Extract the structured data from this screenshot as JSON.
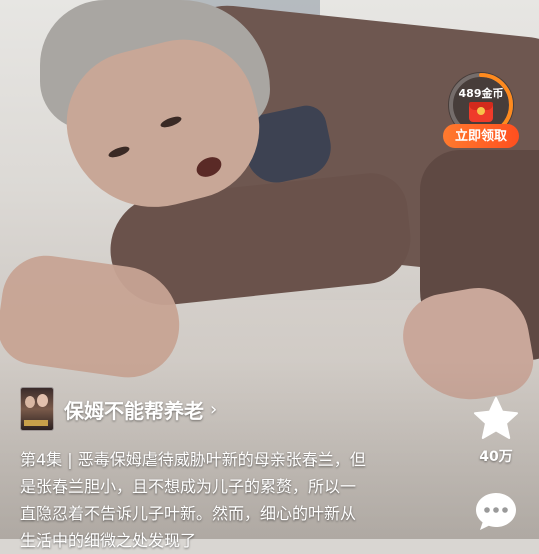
{
  "reward": {
    "coins_label": "489金币",
    "claim_label": "立即领取",
    "progress": 0.45
  },
  "drama": {
    "title": "保姆不能帮养老",
    "chevron": "›",
    "cover_icon": "drama-cover-thumbnail"
  },
  "episode": {
    "description": "第4集 | 恶毒保姆虐待威胁叶新的母亲张春兰，但是张春兰胆小，且不想成为儿子的累赘，所以一直隐忍着不告诉儿子叶新。然而，细心的叶新从生活中的细微之处发现了"
  },
  "actions": {
    "like_icon": "star-icon",
    "like_count": "40万",
    "comment_icon": "comment-icon"
  },
  "colors": {
    "accent_orange": "#ff5a1f",
    "ring_orange": "#ff8a1e",
    "text": "#ffffff"
  }
}
